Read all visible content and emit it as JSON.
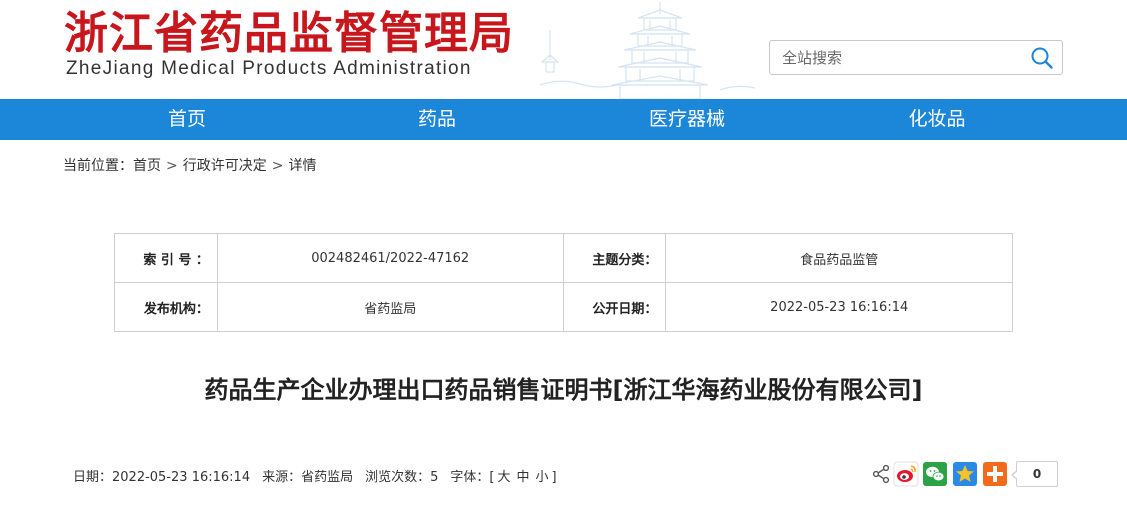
{
  "header": {
    "logo_cn": "浙江省药品监督管理局",
    "logo_en": "ZheJiang Medical Products Administration"
  },
  "search": {
    "placeholder": "全站搜索",
    "value": ""
  },
  "nav": {
    "items": [
      "首页",
      "药品",
      "医疗器械",
      "化妆品"
    ]
  },
  "breadcrumb": {
    "prefix": "当前位置：",
    "items": [
      "首页",
      "行政许可决定",
      "详情"
    ],
    "separator": ">"
  },
  "meta": {
    "index_label": "索 引 号 ：",
    "index_value": "002482461/2022-47162",
    "category_label": "主题分类：",
    "category_value": "食品药品监管",
    "publisher_label": "发布机构：",
    "publisher_value": "省药监局",
    "date_label": "公开日期：",
    "date_value": "2022-05-23 16:16:14"
  },
  "article": {
    "title": "药品生产企业办理出口药品销售证明书[浙江华海药业股份有限公司]"
  },
  "info": {
    "date_label": "日期：",
    "date_value": "2022-05-23 16:16:14",
    "source_label": "来源：",
    "source_value": "省药监局",
    "views_label": "浏览次数：",
    "views_value": "5",
    "font_label": "字体：[",
    "font_large": "大",
    "font_medium": "中",
    "font_small": "小",
    "font_close": "]"
  },
  "share": {
    "icons": [
      "share-icon",
      "weibo-icon",
      "wechat-icon",
      "qzone-icon",
      "more-share-icon"
    ],
    "count": "0"
  },
  "colors": {
    "brand_red": "#c8161d",
    "nav_blue": "#1c86d8"
  }
}
